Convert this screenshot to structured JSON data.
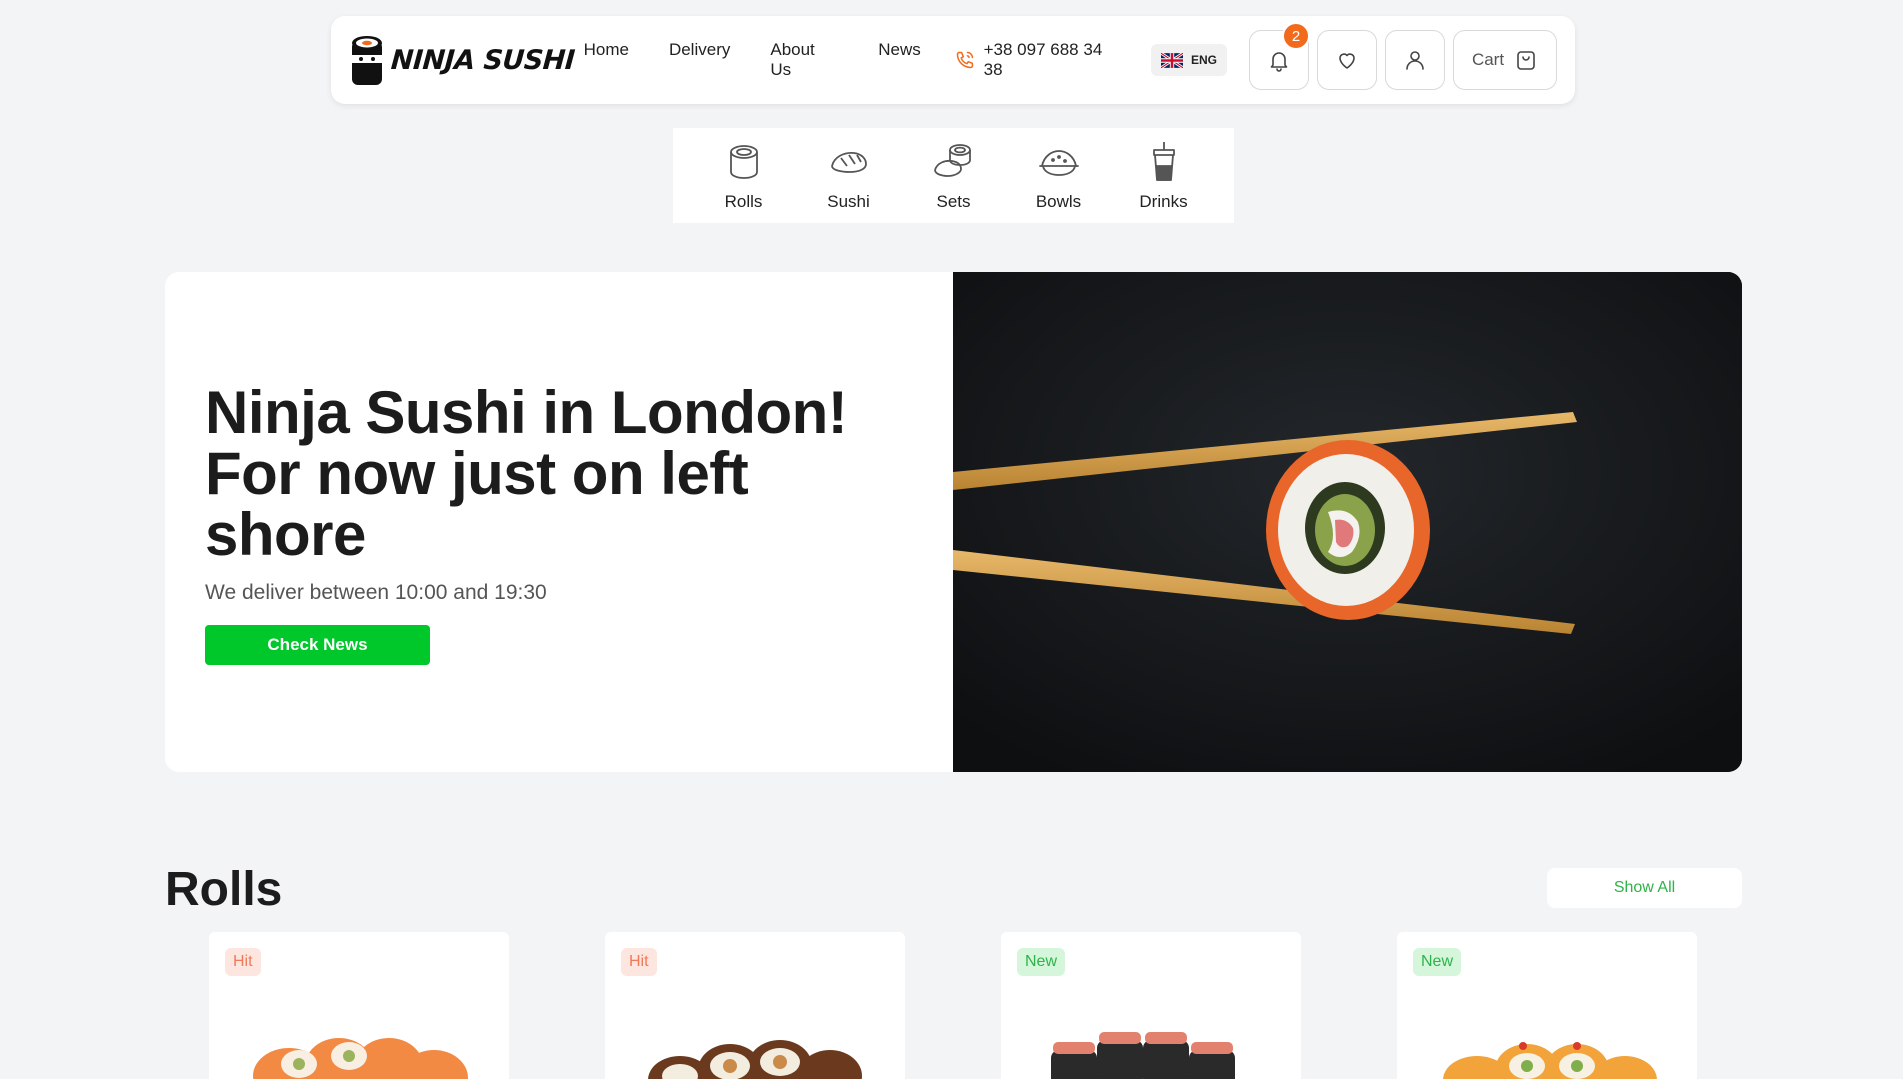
{
  "brand": {
    "name": "NINJA SUSHI"
  },
  "nav": [
    {
      "label": "Home"
    },
    {
      "label": "Delivery"
    },
    {
      "label": "About Us"
    },
    {
      "label": "News"
    }
  ],
  "contact": {
    "phone": "+38 097 688 34 38",
    "icon": "phone-icon"
  },
  "language": {
    "code": "ENG",
    "flag": "uk-flag-icon"
  },
  "notifications": {
    "count": "2"
  },
  "cart": {
    "label": "Cart"
  },
  "categories": [
    {
      "label": "Rolls",
      "icon": "roll-icon"
    },
    {
      "label": "Sushi",
      "icon": "sushi-icon"
    },
    {
      "label": "Sets",
      "icon": "sets-icon"
    },
    {
      "label": "Bowls",
      "icon": "bowl-icon"
    },
    {
      "label": "Drinks",
      "icon": "drink-icon"
    }
  ],
  "hero": {
    "title_line1": "Ninja Sushi in London!",
    "title_line2": "For now just on left",
    "title_line3": "shore",
    "subtitle": "We deliver between 10:00 and 19:30",
    "button": "Check News"
  },
  "rolls": {
    "title": "Rolls",
    "show_all": "Show All",
    "cards": [
      {
        "tag": "Hit",
        "tag_type": "hit"
      },
      {
        "tag": "Hit",
        "tag_type": "hit"
      },
      {
        "tag": "New",
        "tag_type": "new"
      },
      {
        "tag": "New",
        "tag_type": "new"
      }
    ]
  },
  "colors": {
    "accent_green": "#00c82a",
    "badge_orange": "#f26b1d",
    "hit_text": "#f07a57",
    "new_text": "#2db34a"
  }
}
